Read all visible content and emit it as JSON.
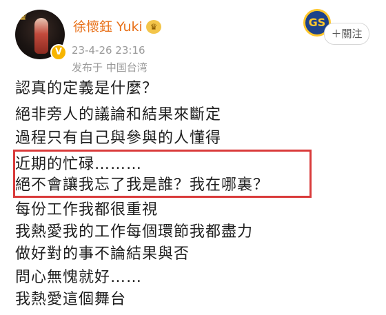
{
  "post": {
    "author": {
      "name": "徐懷鈺 Yuki",
      "verified_mark": "V",
      "vip_icon": "crown-icon",
      "avatar_badge": "♛"
    },
    "timestamp": "23-4-26 23:16",
    "location": "发布于 中国台湾",
    "follow_button": "＋關注",
    "team_logo_icon": "basketball-team-logo",
    "team_logo_text": "GS",
    "lines": [
      "認真的定義是什麼？",
      "絕非旁人的議論和結果來斷定",
      "過程只有自己與參與的人懂得",
      "近期的忙碌………",
      "絕不會讓我忘了我是誰？我在哪裏？",
      "每份工作我都很重視",
      "我熱愛我的工作每個環節我都盡力",
      "做好對的事不論結果與否",
      "問心無愧就好……",
      "我熱愛這個舞台"
    ]
  },
  "colors": {
    "username": "#e8711a",
    "meta_text": "#9a9a9a",
    "highlight_border": "#d93a3a",
    "body_text": "#1f1f1f"
  }
}
